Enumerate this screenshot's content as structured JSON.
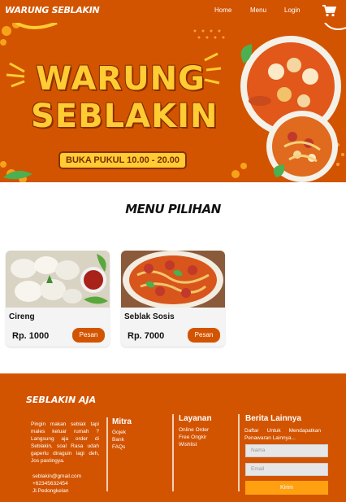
{
  "nav": {
    "brand": "WARUNG SEBLAKIN",
    "links": [
      "Home",
      "Menu",
      "Login"
    ],
    "cart_icon": "cart-icon"
  },
  "hero": {
    "title_line1": "WARUNG",
    "title_line2": "SEBLAKIN",
    "hours": "BUKA PUKUL 10.00 - 20.00"
  },
  "menu": {
    "title": "MENU PILIHAN",
    "items": [
      {
        "name": "Cireng",
        "price": "Rp. 1000",
        "button": "Pesan"
      },
      {
        "name": "Seblak Sosis",
        "price": "Rp. 7000",
        "button": "Pesan"
      }
    ]
  },
  "footer": {
    "brand": "SEBLAKIN AJA",
    "description": "Pingin makan seblak tapi males keluar rumah ? Langsung aja order di Seblakin, soal Rasa udah gaperlu diraguin lagi deh, Jos pastingya.",
    "contact": [
      "seblakin@gmail.com",
      "+62345632454",
      "Jl.Pedongkelan"
    ],
    "mitra": {
      "title": "Mitra",
      "items": [
        "Gojek",
        "Bank",
        "FAQs"
      ]
    },
    "layanan": {
      "title": "Layanan",
      "items": [
        "Online Order",
        "Free Ongkir",
        "Wishlist"
      ]
    },
    "berita": {
      "title": "Berita Lainnya",
      "text": "Daftar Untuk Mendapatkan Penawaran Lainnya...",
      "name_placeholder": "Nama",
      "email_placeholder": "Email",
      "submit": "Kirim"
    }
  },
  "colors": {
    "primary": "#d35400",
    "accent_yellow": "#ffcc33",
    "submit_orange": "#ffa011"
  }
}
